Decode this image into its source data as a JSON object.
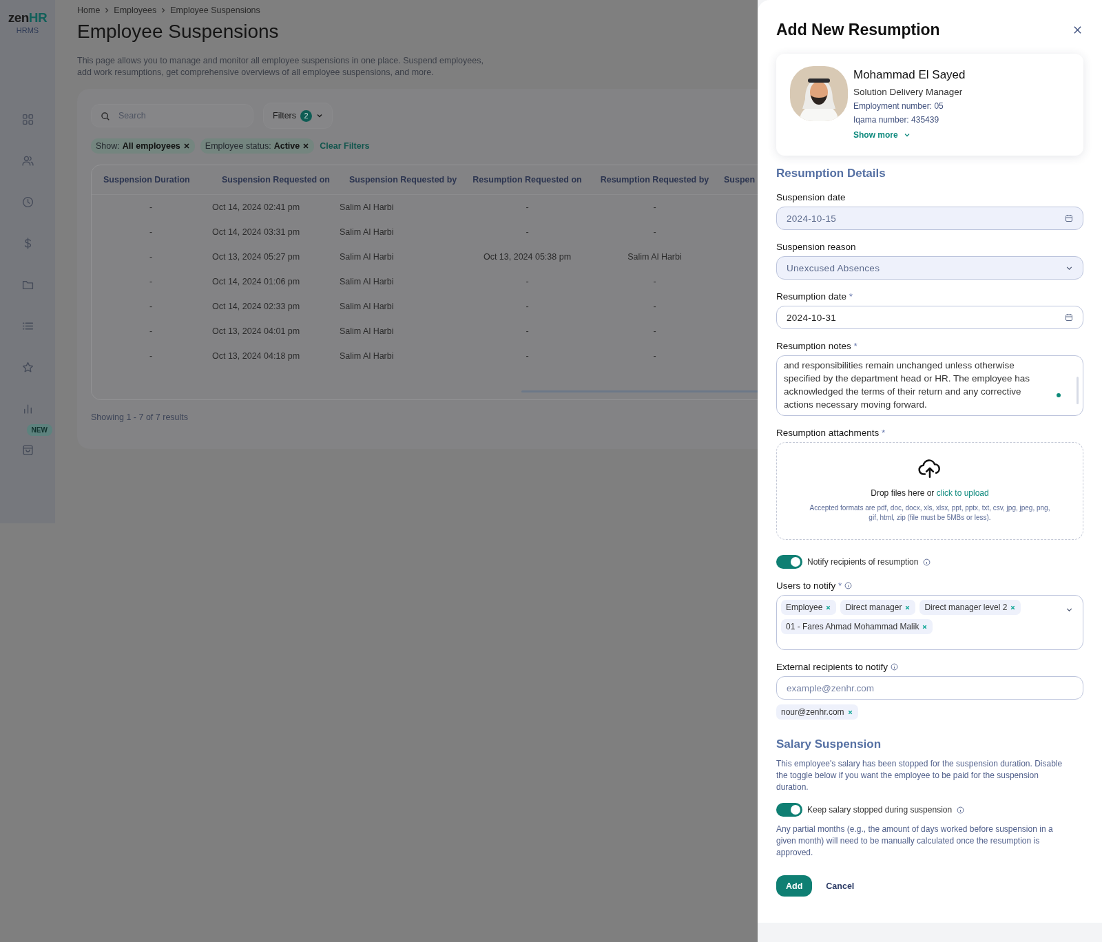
{
  "logo": {
    "part_1": "zen",
    "part_2": "HR",
    "product": "HRMS"
  },
  "sidebar": {
    "new_badge": "NEW"
  },
  "breadcrumb": [
    "Home",
    "Employees",
    "Employee Suspensions"
  ],
  "page": {
    "title": "Employee Suspensions",
    "description": "This page allows you to manage and monitor all employee suspensions in one place. Suspend employees, add work resumptions, get comprehensive overviews of all employee suspensions, and more."
  },
  "toolbar": {
    "search": {
      "placeholder": "Search"
    },
    "filters": {
      "label": "Filters",
      "count": "2"
    }
  },
  "active_filters": [
    {
      "label": "Show:",
      "value": "All employees"
    },
    {
      "label": "Employee status:",
      "value": "Active"
    }
  ],
  "clear_filters": "Clear Filters",
  "table": {
    "columns": [
      "Suspension Duration",
      "Suspension Requested on",
      "Suspension Requested by",
      "Resumption Requested on",
      "Resumption Requested by",
      "Suspen"
    ],
    "rows": [
      [
        "-",
        "Oct 14, 2024 02:41 pm",
        "Salim Al Harbi",
        "-",
        "-"
      ],
      [
        "-",
        "Oct 14, 2024 03:31 pm",
        "Salim Al Harbi",
        "-",
        "-"
      ],
      [
        "-",
        "Oct 13, 2024 05:27 pm",
        "Salim Al Harbi",
        "Oct 13, 2024 05:38 pm",
        "Salim Al Harbi"
      ],
      [
        "-",
        "Oct 14, 2024 01:06 pm",
        "Salim Al Harbi",
        "-",
        "-"
      ],
      [
        "-",
        "Oct 14, 2024 02:33 pm",
        "Salim Al Harbi",
        "-",
        "-"
      ],
      [
        "-",
        "Oct 13, 2024 04:01 pm",
        "Salim Al Harbi",
        "-",
        "-"
      ],
      [
        "-",
        "Oct 13, 2024 04:18 pm",
        "Salim Al Harbi",
        "-",
        "-"
      ]
    ]
  },
  "results": "Showing 1 - 7 of 7 results",
  "panel": {
    "title": "Add New Resumption",
    "employee": {
      "name": "Mohammad El Sayed",
      "role": "Solution Delivery Manager",
      "employment_number": "Employment number: 05",
      "iqama_number": "Iqama number: 435439",
      "show_more": "Show more"
    },
    "details_heading": "Resumption Details",
    "suspension_date": {
      "label": "Suspension date",
      "value": "2024-10-15",
      "disabled": true
    },
    "suspension_reason": {
      "label": "Suspension reason",
      "value": "Unexcused Absences",
      "disabled": true
    },
    "resumption_date": {
      "label": "Resumption date",
      "required_mark": "*",
      "value": "2024-10-31",
      "disabled": false
    },
    "resumption_notes": {
      "label": "Resumption notes",
      "required_mark": "*",
      "value": "and responsibilities remain unchanged unless otherwise specified by the department head or HR. The employee has acknowledged the terms of their return and any corrective actions necessary moving forward."
    },
    "attachments": {
      "label": "Resumption attachments",
      "required_mark": "*",
      "drop_text": "Drop files here or",
      "upload_link": "click to upload",
      "formats": "Accepted formats are pdf, doc, docx, xls, xlsx, ppt, pptx, txt, csv, jpg, jpeg, png, gif, html, zip (file must be 5MBs or less)."
    },
    "notify_toggle": {
      "label": "Notify recipients of resumption",
      "on": true
    },
    "users_to_notify": {
      "label": "Users to notify",
      "required_mark": "*",
      "tags": [
        "Employee",
        "Direct manager",
        "Direct manager level 2",
        "01 - Fares Ahmad Mohammad Malik"
      ]
    },
    "external_recipients": {
      "label": "External recipients to notify",
      "placeholder": "example@zenhr.com",
      "tags": [
        "nour@zenhr.com"
      ]
    },
    "salary_heading": "Salary Suspension",
    "salary_description": "This employee's salary has been stopped for the suspension duration. Disable the toggle below if you want the employee to be paid for the suspension duration.",
    "salary_toggle": {
      "label": "Keep salary stopped during suspension",
      "on": true
    },
    "salary_note": "Any partial months (e.g., the amount of days worked before suspension in a given month) will need to be manually calculated once the resumption is approved.",
    "buttons": {
      "primary": "Add",
      "secondary": "Cancel"
    }
  }
}
